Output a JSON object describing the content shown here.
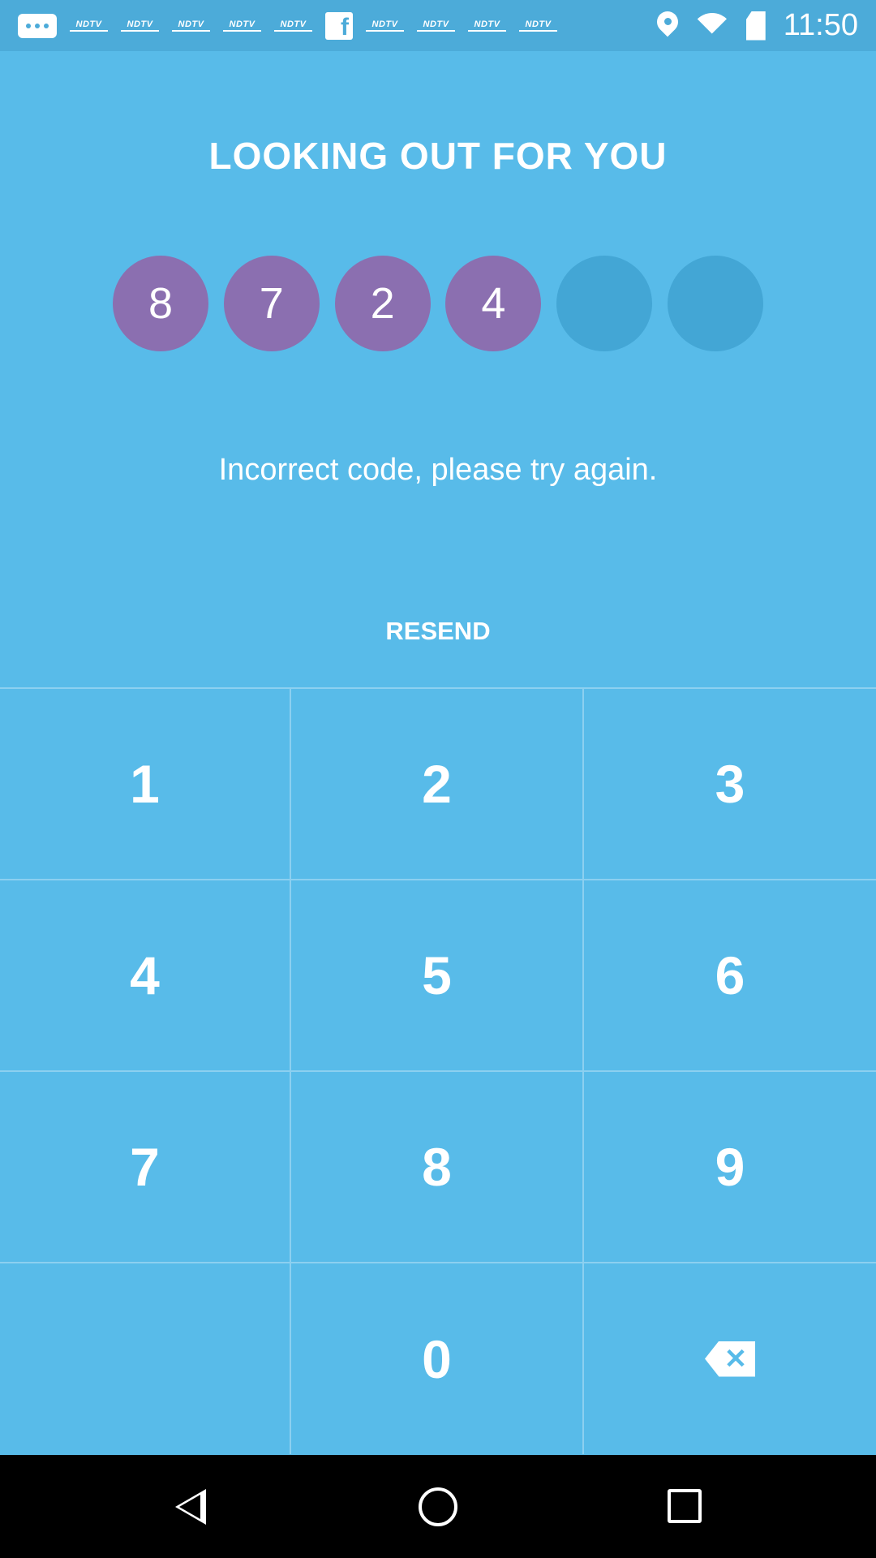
{
  "status_bar": {
    "notifications": [
      "message-icon",
      "NDTV",
      "NDTV",
      "NDTV",
      "NDTV",
      "NDTV",
      "facebook-icon",
      "NDTV",
      "NDTV",
      "NDTV",
      "NDTV"
    ],
    "ndtv_label": "NDTV",
    "facebook_glyph": "f",
    "time": "11:50"
  },
  "title": "LOOKING OUT FOR YOU",
  "code": {
    "digits": [
      "8",
      "7",
      "2",
      "4",
      "",
      ""
    ],
    "filled_color": "#8B6FB0",
    "empty_color": "#43A6D5"
  },
  "error_message": "Incorrect code, please try again.",
  "resend_label": "RESEND",
  "keypad": {
    "keys": [
      "1",
      "2",
      "3",
      "4",
      "5",
      "6",
      "7",
      "8",
      "9",
      "",
      "0",
      "backspace-icon"
    ],
    "backspace_glyph": "✕"
  },
  "colors": {
    "background": "#58BBE9",
    "status_bar": "#4CABD9",
    "divider": "#8CD0F0",
    "nav_bar": "#000000"
  }
}
